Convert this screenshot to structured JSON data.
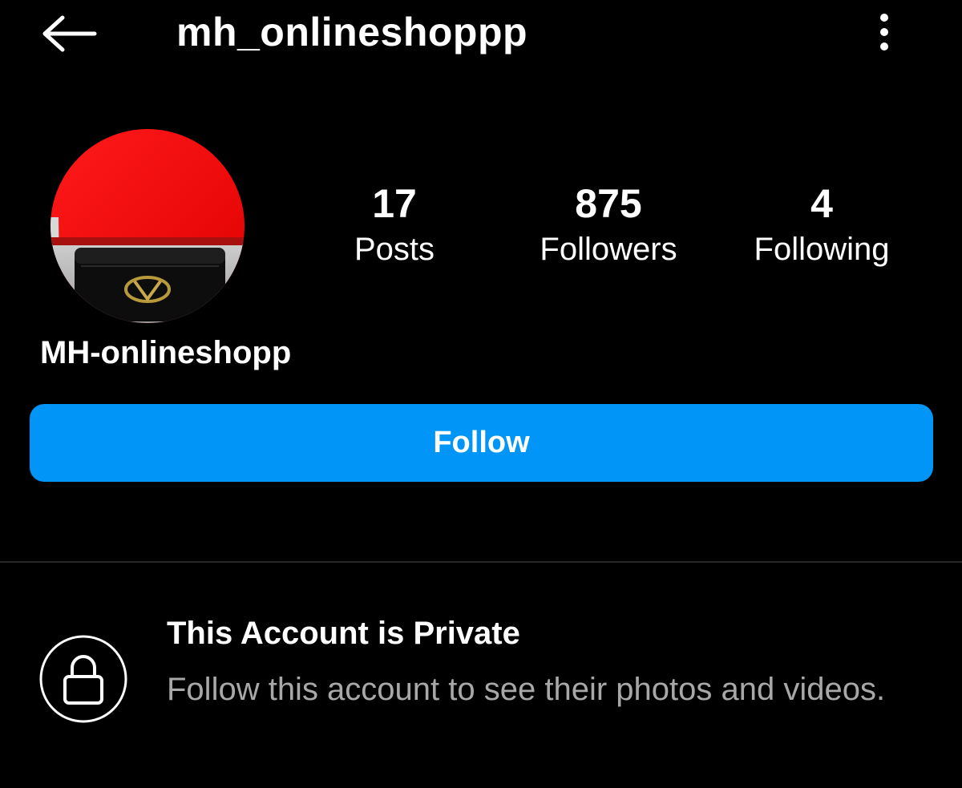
{
  "header": {
    "username": "mh_onlineshoppp",
    "back_icon": "arrow-left-icon",
    "menu_icon": "vertical-dots-icon"
  },
  "profile": {
    "avatar_description": "profile-photo",
    "display_name": "MH-onlineshopp",
    "stats": [
      {
        "value": "17",
        "label": "Posts"
      },
      {
        "value": "875",
        "label": "Followers"
      },
      {
        "value": "4",
        "label": "Following"
      }
    ]
  },
  "actions": {
    "follow_label": "Follow"
  },
  "private_notice": {
    "icon": "lock-icon",
    "title": "This Account is Private",
    "message": "Follow this account to see their photos and videos."
  },
  "colors": {
    "background": "#000000",
    "accent": "#0095f6",
    "text_primary": "#ffffff",
    "text_secondary": "#a8a8a8",
    "divider": "#262626"
  }
}
